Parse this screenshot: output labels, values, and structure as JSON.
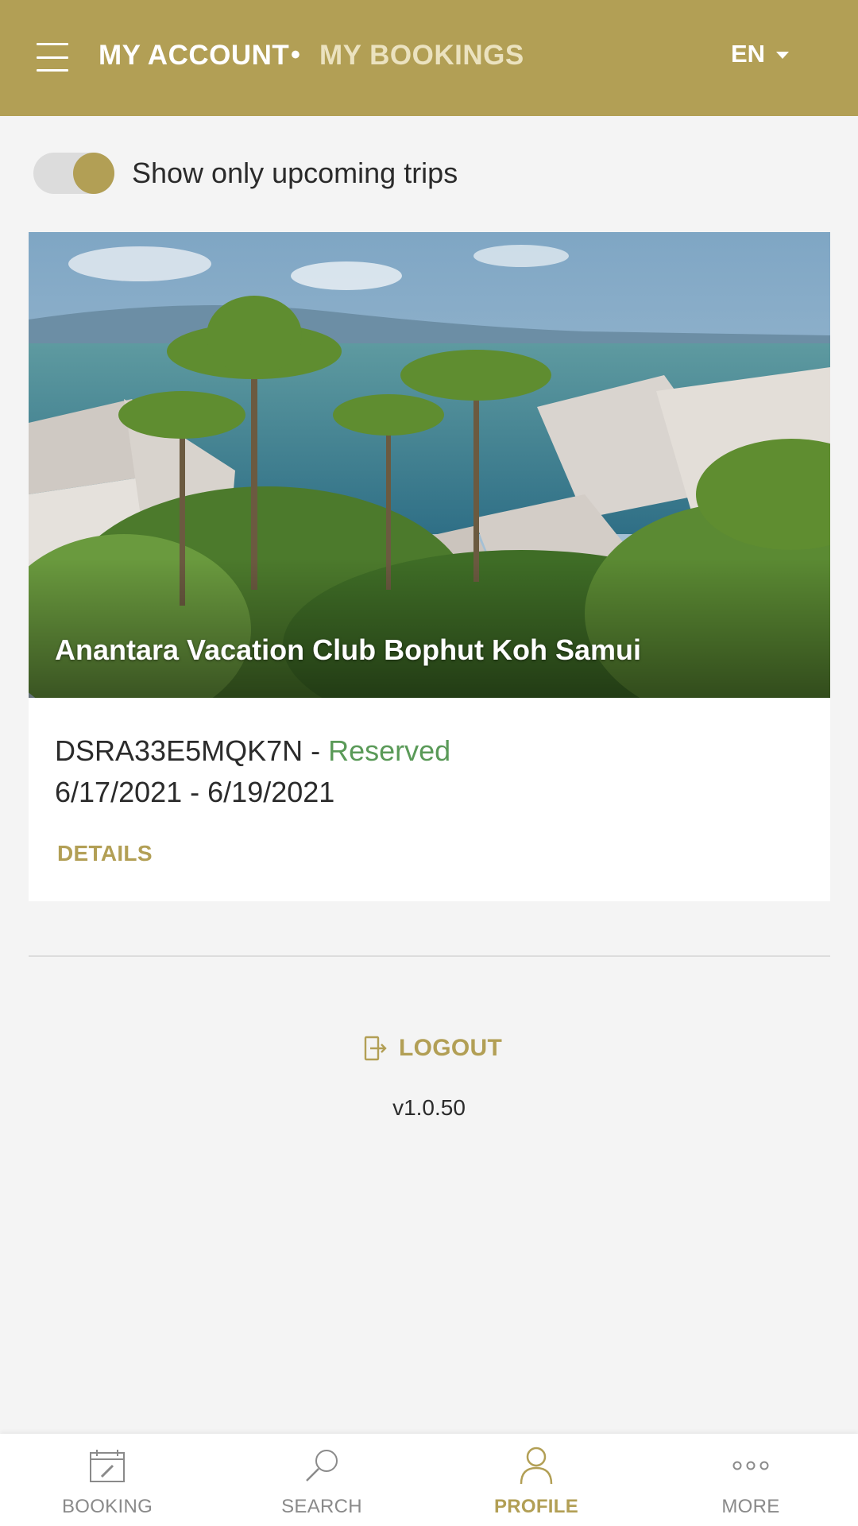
{
  "colors": {
    "brand_gold": "#b29f55",
    "header_sub": "#ebe2bf",
    "status_green": "#5a9a58",
    "background": "#f4f4f4"
  },
  "header": {
    "title": "MY ACCOUNT",
    "separator": "•",
    "subtitle": "MY BOOKINGS",
    "language": "EN"
  },
  "filter": {
    "toggle_label": "Show only upcoming trips",
    "toggle_on": true
  },
  "booking": {
    "hotel_name": "Anantara Vacation Club Bophut Koh Samui",
    "code": "DSRA33E5MQK7N",
    "code_separator": " - ",
    "status": "Reserved",
    "dates": "6/17/2021 - 6/19/2021",
    "details_label": "DETAILS"
  },
  "logout": {
    "label": "LOGOUT"
  },
  "version": "v1.0.50",
  "bottom_nav": {
    "items": [
      {
        "label": "BOOKING",
        "icon": "calendar-edit-icon",
        "active": false
      },
      {
        "label": "SEARCH",
        "icon": "search-icon",
        "active": false
      },
      {
        "label": "PROFILE",
        "icon": "user-icon",
        "active": true
      },
      {
        "label": "MORE",
        "icon": "more-dots-icon",
        "active": false
      }
    ]
  }
}
